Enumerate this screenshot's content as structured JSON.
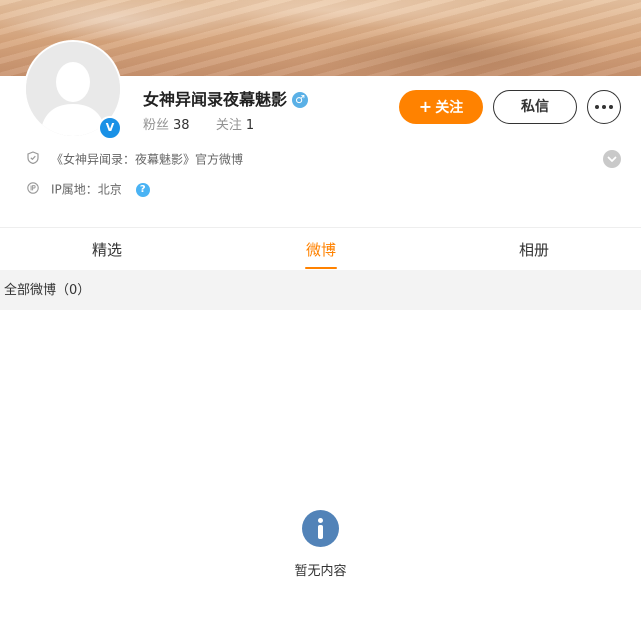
{
  "profile": {
    "name": "女神异闻录夜幕魅影",
    "verified_badge": "V",
    "gender_symbol": "♂",
    "fans_label": "粉丝",
    "fans_count": "38",
    "following_label": "关注",
    "following_count": "1",
    "description": "《女神异闻录：夜幕魅影》官方微博",
    "ip_label": "IP属地：北京",
    "help_symbol": "?"
  },
  "actions": {
    "follow_plus": "+",
    "follow_label": "关注",
    "message_label": "私信"
  },
  "tabs": [
    {
      "label": "精选",
      "active": false
    },
    {
      "label": "微博",
      "active": true
    },
    {
      "label": "相册",
      "active": false
    }
  ],
  "feed": {
    "header": "全部微博（0）",
    "empty_text": "暂无内容"
  },
  "colors": {
    "accent": "#ff8200",
    "verified": "#1a91e6",
    "empty_icon": "#5283b8"
  },
  "icons": {
    "avatar": "default-avatar-icon",
    "gender": "male-icon",
    "more": "more-dots-icon",
    "description": "shield-icon",
    "ip": "ip-location-icon",
    "help": "help-icon",
    "expand": "chevron-down-icon",
    "empty": "info-icon"
  }
}
